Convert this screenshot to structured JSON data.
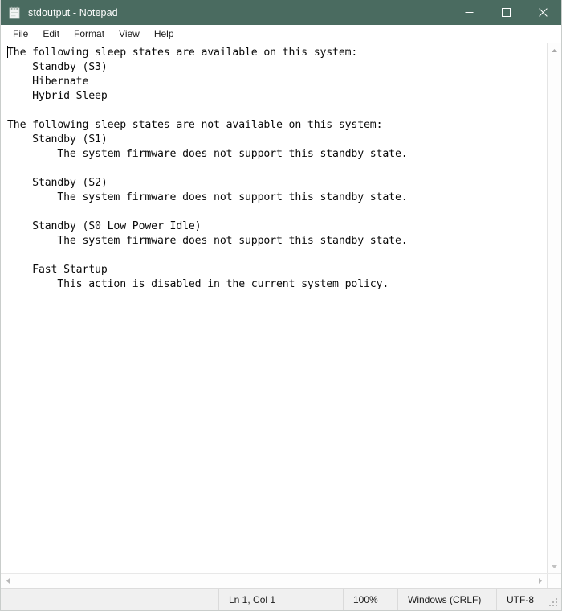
{
  "window": {
    "title": "stdoutput - Notepad",
    "icon": "notepad-icon",
    "titlebar_color": "#4a6b60",
    "controls": {
      "minimize": "minimize-icon",
      "maximize": "maximize-icon",
      "close": "close-icon"
    }
  },
  "menu": {
    "items": [
      {
        "label": "File"
      },
      {
        "label": "Edit"
      },
      {
        "label": "Format"
      },
      {
        "label": "View"
      },
      {
        "label": "Help"
      }
    ]
  },
  "editor": {
    "text": "The following sleep states are available on this system:\n    Standby (S3)\n    Hibernate\n    Hybrid Sleep\n\nThe following sleep states are not available on this system:\n    Standby (S1)\n        The system firmware does not support this standby state.\n\n    Standby (S2)\n        The system firmware does not support this standby state.\n\n    Standby (S0 Low Power Idle)\n        The system firmware does not support this standby state.\n\n    Fast Startup\n        This action is disabled in the current system policy."
  },
  "scrollbars": {
    "vertical": {
      "up_arrow": "scroll-up-icon",
      "down_arrow": "scroll-down-icon"
    },
    "horizontal": {
      "left_arrow": "scroll-left-icon",
      "right_arrow": "scroll-right-icon"
    }
  },
  "statusbar": {
    "position": "Ln 1, Col 1",
    "zoom": "100%",
    "line_ending": "Windows (CRLF)",
    "encoding": "UTF-8"
  }
}
